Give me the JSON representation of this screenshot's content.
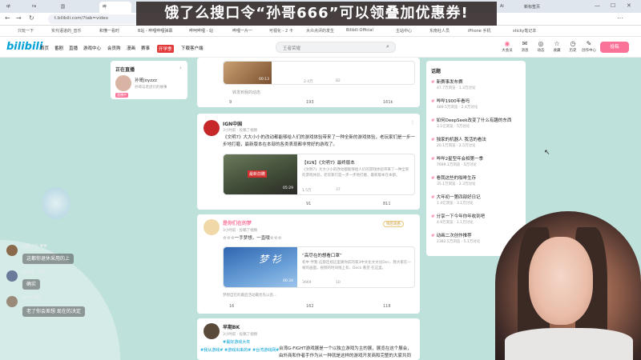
{
  "browser": {
    "tabs": [
      {
        "label": "qt",
        "active": false
      },
      {
        "label": "ra",
        "active": false
      },
      {
        "label": "国",
        "active": false
      },
      {
        "label": "哔",
        "active": true
      },
      {
        "label": "Ai",
        "active": false
      },
      {
        "label": "新标签页",
        "active": false
      }
    ],
    "url": "t.bilibili.com/?tab=video",
    "bookmarks": [
      "只玩一下",
      "实代语道的_音乐",
      "和懂一看时",
      "B站 - 哔哩哔哩弹幕",
      "哔呵哔哩 - 站",
      "哔哩一片一",
      "可视化 - 2 卡",
      "大众点评的发生",
      "Bilibili Official",
      "主站中心",
      "东南社人员",
      "iPhone 手机",
      "sticky笔记本"
    ]
  },
  "banner": {
    "text": "饿了么搜口令“孙哥666”可以领叠加优惠券!"
  },
  "header": {
    "logo": "bilibili",
    "nav": [
      "首页",
      "番剧",
      "直播",
      "游戏中心",
      "会员购",
      "漫画",
      "赛事",
      "开学季",
      "下载客户端"
    ],
    "search_placeholder": "王者荣耀",
    "icons": [
      {
        "icon": "avatar-icon",
        "label": "大会员"
      },
      {
        "icon": "message-icon",
        "label": "消息"
      },
      {
        "icon": "dynamic-icon",
        "label": "动态"
      },
      {
        "icon": "favorite-icon",
        "label": "收藏"
      },
      {
        "icon": "history-icon",
        "label": "历史"
      },
      {
        "icon": "creator-icon",
        "label": "创作中心"
      }
    ],
    "upload_label": "投稿"
  },
  "live": {
    "title": "正在直播",
    "more": "›",
    "streamer": "孙哥Joyzzz",
    "desc": "孙哥与老虎们的故事",
    "badge": "直播中"
  },
  "feed": [
    {
      "video_stats": {
        "views": "2.4万",
        "danmaku": "82"
      },
      "duration": "00:13",
      "actions": {
        "forward": "9",
        "comment": "193",
        "like": "161k"
      },
      "action_label": "转发到我的动态"
    },
    {
      "user": "IGN中国",
      "meta": "3小时前 · 投稿了视频",
      "text": "《文明7》大大小小的改动都能够给人们的游戏体验带来了一种全新的游戏体验，老玩家们是一步一步地打磨，最新版本在本部的各类表现都非常好的游戏了。",
      "video": {
        "title": "【IGN】《文明7》最终版本",
        "desc": "《文明7》大大小小的改动都能够给人们的游戏体验带来了一种全新的游戏体验，老玩家们是一步一步地打磨，最新版本在本部。",
        "views": "1.5万",
        "danmaku": "37",
        "duration": "05:29",
        "thumb_text": "最新前瞻"
      },
      "actions": {
        "forward": "",
        "comment": "91",
        "like": "811"
      }
    },
    {
      "user": "是你们在的梦",
      "meta": "3小时前 · 投稿了视频",
      "tag": "稍后观看",
      "text": "☆☆☆一手梦想，一直哦☆☆☆",
      "video": {
        "title": "“高尽在的想看口罩”",
        "desc": "初中 伴我 这部连视这里跟你前的第3中文化文文化Doc，我大家在一帧的画面，视频的时间线上有，Dock 看见 在这里。",
        "views": "3669",
        "danmaku": "10",
        "duration": "00:34",
        "thumb_text": "梦 衫"
      },
      "footer": "梦想自在的最后活动最优先以后...",
      "actions": {
        "forward": "16",
        "comment": "162",
        "like": "118"
      }
    },
    {
      "user": "早期BK",
      "meta": "3小时前 · 投稿了视频",
      "topic": "#最好游戏大年",
      "tags": "#我从游戏#  #游戏出来的#  #台湾游戏网#",
      "text": "台湾G-FIGHT游戏展是一个以独立游戏为主的展，展览在这个展会，由外商和作者手作为从一种就是这样的游戏开发商和完整的大家共同参与……"
    }
  ],
  "trending": {
    "title": "话题",
    "items": [
      {
        "title": "新赛事发布赛",
        "count": "47.7万浏览 · 1.3万讨论"
      },
      {
        "title": "哔哔1900年看吗",
        "count": "489.5万浏览 · 2.4万讨论"
      },
      {
        "title": "如何DeepSeek改变了什么有趣的东西",
        "count": "3.1亿浏览 · 5万讨论"
      },
      {
        "title": "独家的机器人 我活的看法",
        "count": "20.1万浏览 · 2.5万讨论"
      },
      {
        "title": "哔哔2星型年会相第一季",
        "count": "7699.1万浏览 · 5万讨论"
      },
      {
        "title": "看我这些的咖啡生存",
        "count": "35.1万浏览 · 2.3万讨论"
      },
      {
        "title": "大年初一第四部好日记",
        "count": "1.4亿浏览 · 3.1万讨论"
      },
      {
        "title": "分享一下今年你年收到吧",
        "count": "4.9万浏览 · 1.1万讨论"
      },
      {
        "title": "动画二次创作推荐",
        "count": "2382.5万浏览 · 5.1万讨论"
      }
    ]
  },
  "chat": [
    {
      "user": "超级小旭 ♥♥",
      "text": "这都你退休采用的上"
    },
    {
      "user": "Kim酒 · 卡娃",
      "text": "确实"
    },
    {
      "user": "Beat 比利",
      "text": "老了你会差想 现在的决定"
    }
  ],
  "colors": {
    "accent": "#00a1d6",
    "pink": "#fb7299",
    "bg": "#bfe1dc"
  }
}
